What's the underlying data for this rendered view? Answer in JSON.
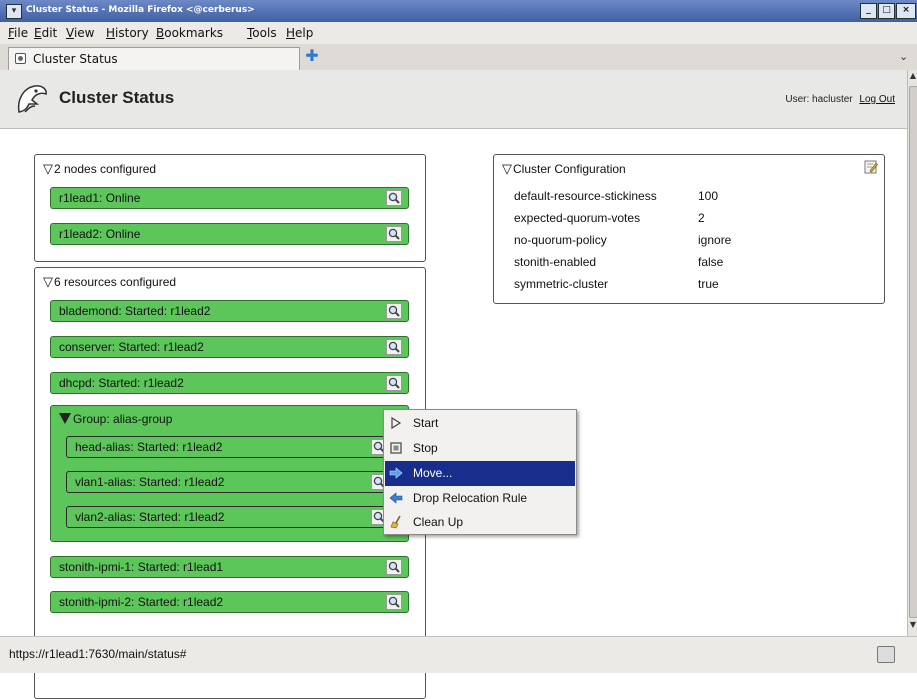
{
  "window": {
    "title": "Cluster Status - Mozilla Firefox <@cerberus>",
    "controls": [
      "minimize-icon",
      "maximize-icon",
      "close-icon"
    ]
  },
  "menubar": {
    "items": [
      "File",
      "Edit",
      "View",
      "History",
      "Bookmarks",
      "Tools",
      "Help"
    ]
  },
  "tabs": {
    "active": "Cluster Status",
    "new_tab_icon": "new-tab-icon",
    "list_icon": "tab-list-icon"
  },
  "header": {
    "title": "Cluster Status",
    "user_label": "User: hacluster",
    "logout_label": "Log Out",
    "logo_icon": "penguin-logo-icon"
  },
  "nodes": {
    "title": "2 nodes configured",
    "items": [
      "r1lead1: Online",
      "r1lead2: Online"
    ]
  },
  "resources": {
    "title": "6 resources configured",
    "items_top": [
      "blademond: Started: r1lead2",
      "conserver: Started: r1lead2",
      "dhcpd: Started: r1lead2"
    ],
    "group": {
      "title": "Group: alias-group",
      "items": [
        "head-alias: Started: r1lead2",
        "vlan1-alias: Started: r1lead2",
        "vlan2-alias: Started: r1lead2"
      ]
    },
    "items_bottom": [
      "stonith-ipmi-1: Started: r1lead1",
      "stonith-ipmi-2: Started: r1lead2"
    ]
  },
  "config": {
    "title": "Cluster Configuration",
    "rows": [
      {
        "key": "default-resource-stickiness",
        "value": "100"
      },
      {
        "key": "expected-quorum-votes",
        "value": "2"
      },
      {
        "key": "no-quorum-policy",
        "value": "ignore"
      },
      {
        "key": "stonith-enabled",
        "value": "false"
      },
      {
        "key": "symmetric-cluster",
        "value": "true"
      }
    ]
  },
  "context_menu": {
    "items": [
      {
        "label": "Start",
        "icon": "start-icon"
      },
      {
        "label": "Stop",
        "icon": "stop-icon"
      },
      {
        "label": "Move...",
        "icon": "move-arrow-icon",
        "selected": true
      },
      {
        "label": "Drop Relocation Rule",
        "icon": "drop-relocation-icon"
      },
      {
        "label": "Clean Up",
        "icon": "broom-icon"
      }
    ]
  },
  "statusbar": {
    "url": "https://r1lead1:7630/main/status#"
  },
  "colors": {
    "resource_green": "#5cc65a",
    "menu_selected": "#172e8c",
    "titlebar": "#4f6fb2"
  }
}
